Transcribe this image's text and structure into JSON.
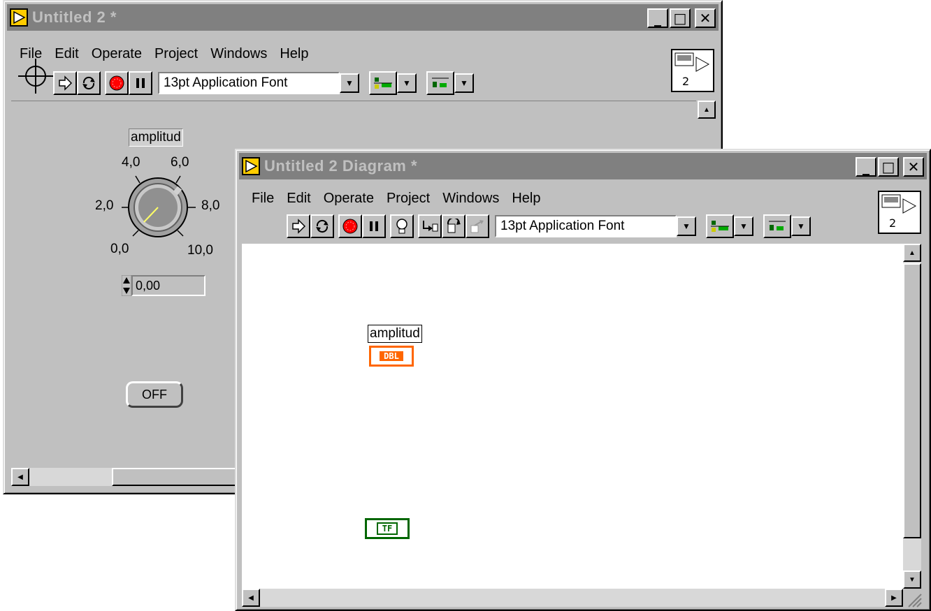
{
  "front_panel": {
    "title": "Untitled 2 *",
    "menu": [
      "File",
      "Edit",
      "Operate",
      "Project",
      "Windows",
      "Help"
    ],
    "font_select": "13pt Application Font",
    "vi_icon_number": "2",
    "knob": {
      "label": "amplitud",
      "ticks": [
        "0,0",
        "2,0",
        "4,0",
        "6,0",
        "8,0",
        "10,0"
      ],
      "value": 0.0
    },
    "numeric_value": "0,00",
    "button_label": "OFF"
  },
  "block_diagram": {
    "title": "Untitled 2 Diagram *",
    "menu": [
      "File",
      "Edit",
      "Operate",
      "Project",
      "Windows",
      "Help"
    ],
    "font_select": "13pt Application Font",
    "vi_icon_number": "2",
    "amplitud_label": "amplitud",
    "dbl_terminal": "DBL",
    "tf_terminal": "TF"
  },
  "colors": {
    "titlebar_inactive": "#808080",
    "dbl_orange": "#ff6600",
    "tf_green": "#006600"
  }
}
